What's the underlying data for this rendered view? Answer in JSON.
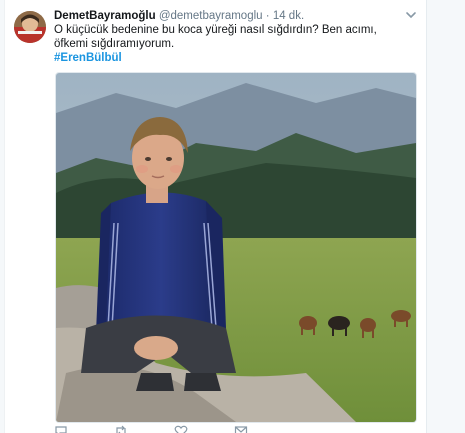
{
  "tweet": {
    "display_name": "DemetBayramoğlu",
    "handle": "@demetbayramoglu",
    "separator": "·",
    "time": "14 dk.",
    "text": "O küçücük bedenine bu koca yüreği nasıl sığdırdın? Ben acımı, öfkemi sığdıramıyorum.",
    "hashtag": "#ErenBülbül"
  },
  "icons": {
    "caret": "chevron-down-icon",
    "reply": "reply-icon",
    "retweet": "retweet-icon",
    "like": "heart-icon",
    "message": "message-icon"
  },
  "colors": {
    "link": "#1b95e0",
    "text": "#14171a",
    "muted": "#657786"
  }
}
